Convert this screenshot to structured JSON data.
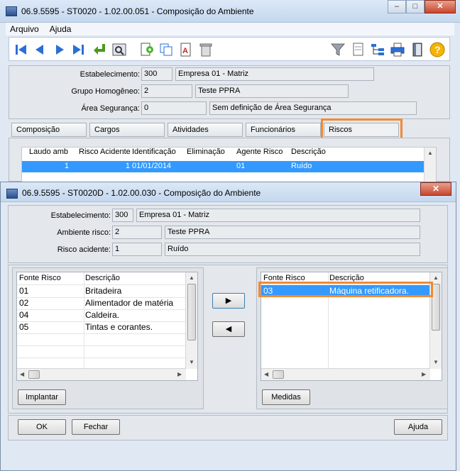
{
  "main_window": {
    "title": "06.9.5595 - ST0020 - 1.02.00.051 - Composição do Ambiente",
    "caption_buttons": {
      "minimize": "–",
      "maximize": "□",
      "close": "✕"
    },
    "menu": [
      "Arquivo",
      "Ajuda"
    ],
    "toolbar_icons": [
      "first-record-icon",
      "previous-record-icon",
      "next-record-icon",
      "last-record-icon",
      "confirm-icon",
      "preview-icon",
      "new-document-icon",
      "copy-icon",
      "edit-text-icon",
      "trash-icon",
      "filter-icon",
      "document-icon",
      "tree-icon",
      "print-icon",
      "exit-icon",
      "help-icon"
    ],
    "header": {
      "estabelecimento_label": "Estabelecimento:",
      "estabelecimento_code": "300",
      "estabelecimento_name": "Empresa 01 - Matriz",
      "grupo_label": "Grupo Homogêneo:",
      "grupo_code": "2",
      "grupo_name": "Teste PPRA",
      "area_label": "Área Segurança:",
      "area_code": "0",
      "area_name": "Sem definição de Área Segurança"
    },
    "tabs": [
      "Composição",
      "Cargos",
      "Atividades",
      "Funcionários",
      "Riscos"
    ],
    "active_tab": "Riscos",
    "risk_grid": {
      "columns": [
        "Laudo amb",
        "Risco Acidente",
        "Identificação",
        "Eliminação",
        "Agente Risco",
        "Descrição"
      ],
      "rows": [
        [
          "1",
          "1",
          "01/01/2014",
          "",
          "01",
          "Ruído"
        ]
      ]
    }
  },
  "dialog": {
    "title": "06.9.5595 - ST0020D - 1.02.00.030 - Composição do Ambiente",
    "close": "✕",
    "estabelecimento_label": "Estabelecimento:",
    "estabelecimento_code": "300",
    "estabelecimento_name": "Empresa 01 - Matriz",
    "ambiente_label": "Ambiente risco:",
    "ambiente_code": "2",
    "ambiente_name": "Teste PPRA",
    "risco_label": "Risco acidente:",
    "risco_code": "1",
    "risco_name": "Ruído",
    "available": {
      "columns": [
        "Fonte Risco",
        "Descrição"
      ],
      "rows": [
        [
          "01",
          "Britadeira"
        ],
        [
          "02",
          "Alimentador de matéria"
        ],
        [
          "04",
          "Caldeira."
        ],
        [
          "05",
          "Tintas e corantes."
        ]
      ]
    },
    "selected": {
      "columns": [
        "Fonte Risco",
        "Descrição"
      ],
      "rows": [
        [
          "03",
          "Máquina retificadora."
        ]
      ]
    },
    "move_right_label": "▶",
    "move_left_label": "◀",
    "implantar_label": "Implantar",
    "medidas_label": "Medidas",
    "ok_label": "OK",
    "fechar_label": "Fechar",
    "ajuda_label": "Ajuda"
  },
  "colors": {
    "highlight": "#f08a33",
    "selection": "#3399ff"
  }
}
